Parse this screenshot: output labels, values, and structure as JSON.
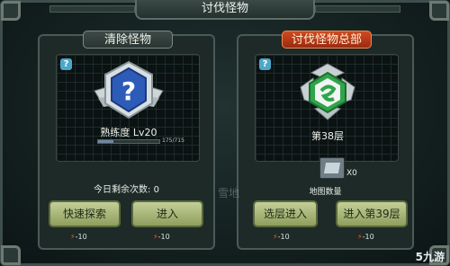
{
  "header": {
    "title": "讨伐怪物"
  },
  "left_panel": {
    "title": "清除怪物",
    "help_icon": "?",
    "emblem_icon": "question-shield-icon",
    "mastery_label": "熟练度 Lv20",
    "mastery_progress": "175/715",
    "mastery_fraction": 0.245,
    "attempts_label": "今日剩余次数: 0",
    "buttons": [
      {
        "label": "快速探索",
        "cost": "-10"
      },
      {
        "label": "进入",
        "cost": "-10"
      }
    ]
  },
  "right_panel": {
    "title": "讨伐怪物总部",
    "help_icon": "?",
    "emblem_icon": "green-hq-emblem-icon",
    "floor_label": "第38层",
    "map_icon": "map-scroll-icon",
    "map_count": "X0",
    "map_label": "地图数量",
    "buttons": [
      {
        "label": "选层进入",
        "cost": "-10"
      },
      {
        "label": "进入第39层",
        "cost": "-10"
      }
    ]
  },
  "watermarks": {
    "center": "雪地",
    "corner": "5九游"
  },
  "colors": {
    "accent_orange": "#cf4a20",
    "button_green": "#b4c283",
    "energy_bolt": "#ff5a2c"
  }
}
